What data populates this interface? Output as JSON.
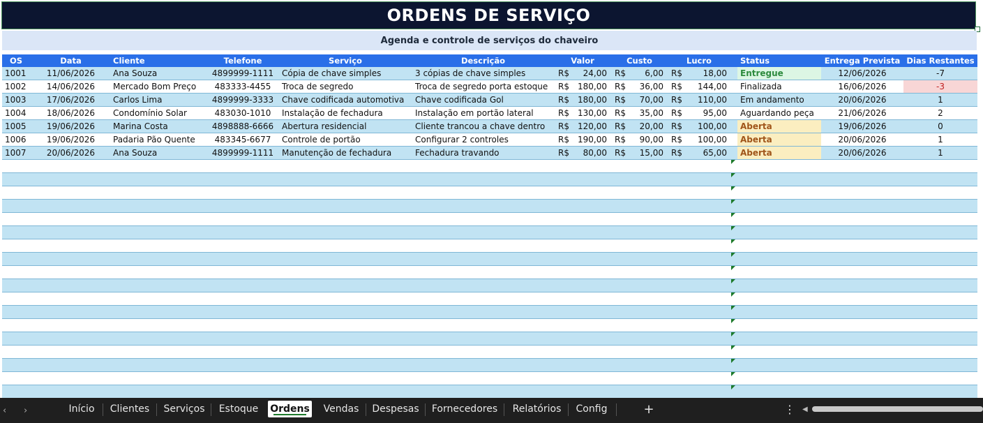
{
  "title": "ORDENS DE SERVIÇO",
  "subtitle": "Agenda e controle de serviços do chaveiro",
  "columns": [
    "OS",
    "Data",
    "Cliente",
    "Telefone",
    "Serviço",
    "Descrição",
    "Valor",
    "Custo",
    "Lucro",
    "Status",
    "Entrega Prevista",
    "Dias Restantes"
  ],
  "currency": "R$",
  "rows": [
    {
      "os": "1001",
      "data": "11/06/2026",
      "cliente": "Ana Souza",
      "telefone": "4899999-1111",
      "servico": "Cópia de chave simples",
      "descricao": "3 cópias de chave simples",
      "valor": "24,00",
      "custo": "6,00",
      "lucro": "18,00",
      "status": "Entregue",
      "entrega": "12/06/2026",
      "dias": "-7"
    },
    {
      "os": "1002",
      "data": "14/06/2026",
      "cliente": "Mercado Bom Preço",
      "telefone": "483333-4455",
      "servico": "Troca de segredo",
      "descricao": "Troca de segredo porta estoque",
      "valor": "180,00",
      "custo": "36,00",
      "lucro": "144,00",
      "status": "Finalizada",
      "entrega": "16/06/2026",
      "dias": "-3"
    },
    {
      "os": "1003",
      "data": "17/06/2026",
      "cliente": "Carlos Lima",
      "telefone": "4899999-3333",
      "servico": "Chave codificada automotiva",
      "descricao": "Chave codificada Gol",
      "valor": "180,00",
      "custo": "70,00",
      "lucro": "110,00",
      "status": "Em andamento",
      "entrega": "20/06/2026",
      "dias": "1"
    },
    {
      "os": "1004",
      "data": "18/06/2026",
      "cliente": "Condomínio Solar",
      "telefone": "483030-1010",
      "servico": "Instalação de fechadura",
      "descricao": "Instalação em portão lateral",
      "valor": "130,00",
      "custo": "35,00",
      "lucro": "95,00",
      "status": "Aguardando peça",
      "entrega": "21/06/2026",
      "dias": "2"
    },
    {
      "os": "1005",
      "data": "19/06/2026",
      "cliente": "Marina Costa",
      "telefone": "4898888-6666",
      "servico": "Abertura residencial",
      "descricao": "Cliente trancou a chave dentro",
      "valor": "120,00",
      "custo": "20,00",
      "lucro": "100,00",
      "status": "Aberta",
      "entrega": "19/06/2026",
      "dias": "0"
    },
    {
      "os": "1006",
      "data": "19/06/2026",
      "cliente": "Padaria Pão Quente",
      "telefone": "483345-6677",
      "servico": "Controle de portão",
      "descricao": "Configurar 2 controles",
      "valor": "190,00",
      "custo": "90,00",
      "lucro": "100,00",
      "status": "Aberta",
      "entrega": "20/06/2026",
      "dias": "1"
    },
    {
      "os": "1007",
      "data": "20/06/2026",
      "cliente": "Ana Souza",
      "telefone": "4899999-1111",
      "servico": "Manutenção de fechadura",
      "descricao": "Fechadura travando",
      "valor": "80,00",
      "custo": "15,00",
      "lucro": "65,00",
      "status": "Aberta",
      "entrega": "20/06/2026",
      "dias": "1"
    }
  ],
  "sheet_tabs": [
    "Início",
    "Clientes",
    "Serviços",
    "Estoque",
    "Ordens",
    "Vendas",
    "Despesas",
    "Fornecedores",
    "Relatórios",
    "Config"
  ],
  "active_tab": "Ordens",
  "add_sheet_label": "+",
  "more_label": "⋮",
  "nav_prev": "‹",
  "nav_next": "›"
}
